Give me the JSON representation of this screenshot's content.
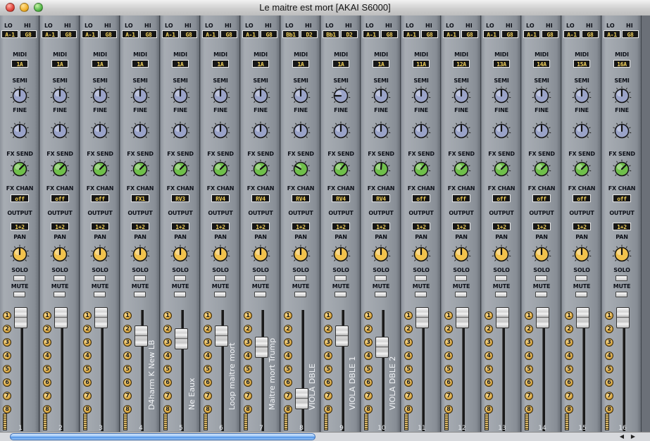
{
  "window": {
    "title": "Le maitre est mort [AKAI S6000]"
  },
  "labels": {
    "lo": "LO",
    "hi": "HI",
    "midi": "MIDI",
    "semi": "SEMI",
    "fine": "FINE",
    "fx_send": "FX SEND",
    "fx_chan": "FX CHAN",
    "output": "OUTPUT",
    "pan": "PAN",
    "solo": "SOLO",
    "mute": "MUTE"
  },
  "colors": {
    "semi_knob": "#9aa3c8",
    "fine_knob": "#9aa3c8",
    "fx_knob": "#6fbf4a",
    "pan_knob": "#f1c24d",
    "display_text": "#f5d35a",
    "display_bg": "#161616"
  },
  "aux_buttons": [
    "1",
    "2",
    "3",
    "4",
    "5",
    "6",
    "7",
    "8"
  ],
  "channels": [
    {
      "num": "1",
      "lo": "A-1",
      "hi": "G8",
      "midi": "1A",
      "fx_chan": "off",
      "output": "1+2",
      "name": "",
      "fader": 0.0
    },
    {
      "num": "2",
      "lo": "A-1",
      "hi": "G8",
      "midi": "1A",
      "fx_chan": "off",
      "output": "1+2",
      "name": "",
      "fader": 0.0
    },
    {
      "num": "3",
      "lo": "A-1",
      "hi": "G8",
      "midi": "1A",
      "fx_chan": "off",
      "output": "1+2",
      "name": "",
      "fader": 0.0
    },
    {
      "num": "4",
      "lo": "A-1",
      "hi": "G8",
      "midi": "1A",
      "fx_chan": "FX1",
      "output": "1+2",
      "name": "D4harm K New LB",
      "fader": 0.16
    },
    {
      "num": "5",
      "lo": "A-1",
      "hi": "G8",
      "midi": "1A",
      "fx_chan": "RV3",
      "output": "1+2",
      "name": "Ne Eaux",
      "fader": 0.19
    },
    {
      "num": "6",
      "lo": "A-1",
      "hi": "G8",
      "midi": "1A",
      "fx_chan": "RV4",
      "output": "1+2",
      "name": "Loop maitre mort",
      "fader": 0.16
    },
    {
      "num": "7",
      "lo": "A-1",
      "hi": "G8",
      "midi": "1A",
      "fx_chan": "RV4",
      "output": "1+2",
      "name": "Maitre mort Trump",
      "fader": 0.26
    },
    {
      "num": "8",
      "lo": "Bb1",
      "hi": "D2",
      "midi": "1A",
      "fx_chan": "RV4",
      "output": "1+2",
      "name": "VIOLA DBLE",
      "fader": 0.72
    },
    {
      "num": "9",
      "lo": "Bb1",
      "hi": "D2",
      "midi": "1A",
      "fx_chan": "RV4",
      "output": "1+2",
      "name": "VIOLA DBLE 1",
      "fader": 0.16
    },
    {
      "num": "10",
      "lo": "A-1",
      "hi": "G8",
      "midi": "1A",
      "fx_chan": "RV4",
      "output": "1+2",
      "name": "VIOLA DBLE 2",
      "fader": 0.26
    },
    {
      "num": "11",
      "lo": "A-1",
      "hi": "G8",
      "midi": "11A",
      "fx_chan": "off",
      "output": "1+2",
      "name": "",
      "fader": 0.0
    },
    {
      "num": "12",
      "lo": "A-1",
      "hi": "G8",
      "midi": "12A",
      "fx_chan": "off",
      "output": "1+2",
      "name": "",
      "fader": 0.0
    },
    {
      "num": "13",
      "lo": "A-1",
      "hi": "G8",
      "midi": "13A",
      "fx_chan": "off",
      "output": "1+2",
      "name": "",
      "fader": 0.0
    },
    {
      "num": "14",
      "lo": "A-1",
      "hi": "G8",
      "midi": "14A",
      "fx_chan": "off",
      "output": "1+2",
      "name": "",
      "fader": 0.0
    },
    {
      "num": "15",
      "lo": "A-1",
      "hi": "G8",
      "midi": "15A",
      "fx_chan": "off",
      "output": "1+2",
      "name": "",
      "fader": 0.0
    },
    {
      "num": "16",
      "lo": "A-1",
      "hi": "G8",
      "midi": "16A",
      "fx_chan": "off",
      "output": "1+2",
      "name": "",
      "fader": 0.0
    }
  ]
}
